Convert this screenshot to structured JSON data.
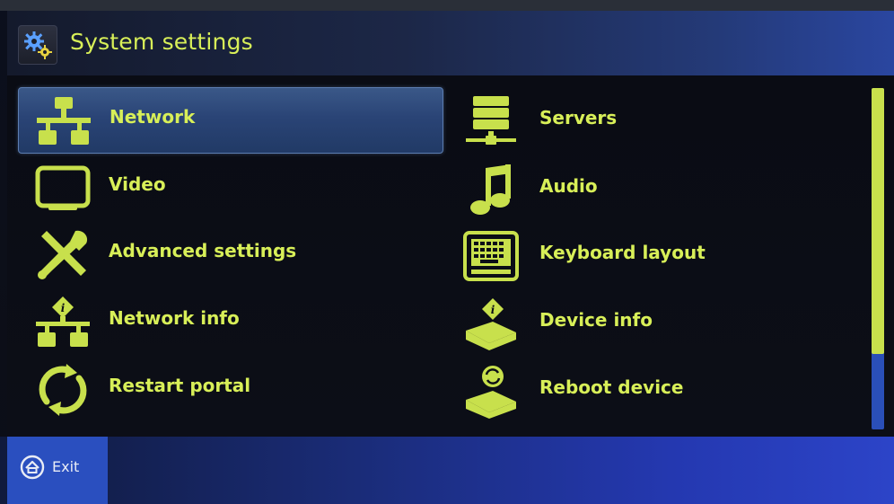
{
  "header": {
    "title": "System settings",
    "icon": "gears-icon"
  },
  "menu": {
    "items": [
      {
        "label": "Network",
        "icon": "network-icon",
        "selected": true
      },
      {
        "label": "Servers",
        "icon": "servers-icon",
        "selected": false
      },
      {
        "label": "Video",
        "icon": "monitor-icon",
        "selected": false
      },
      {
        "label": "Audio",
        "icon": "music-note-icon",
        "selected": false
      },
      {
        "label": "Advanced settings",
        "icon": "tools-icon",
        "selected": false
      },
      {
        "label": "Keyboard layout",
        "icon": "keyboard-icon",
        "selected": false
      },
      {
        "label": "Network info",
        "icon": "network-info-icon",
        "selected": false
      },
      {
        "label": "Device info",
        "icon": "device-info-icon",
        "selected": false
      },
      {
        "label": "Restart portal",
        "icon": "restart-icon",
        "selected": false
      },
      {
        "label": "Reboot device",
        "icon": "reboot-device-icon",
        "selected": false
      }
    ]
  },
  "footer": {
    "exit_label": "Exit",
    "exit_icon": "home-circle-icon"
  },
  "colors": {
    "accent": "#d8ef58",
    "selection": "#2a4476",
    "footer": "#2a4fbf",
    "scroll_track": "#2a4fb8",
    "scroll_thumb": "#c8e04c"
  },
  "scroll_position": 0.78
}
